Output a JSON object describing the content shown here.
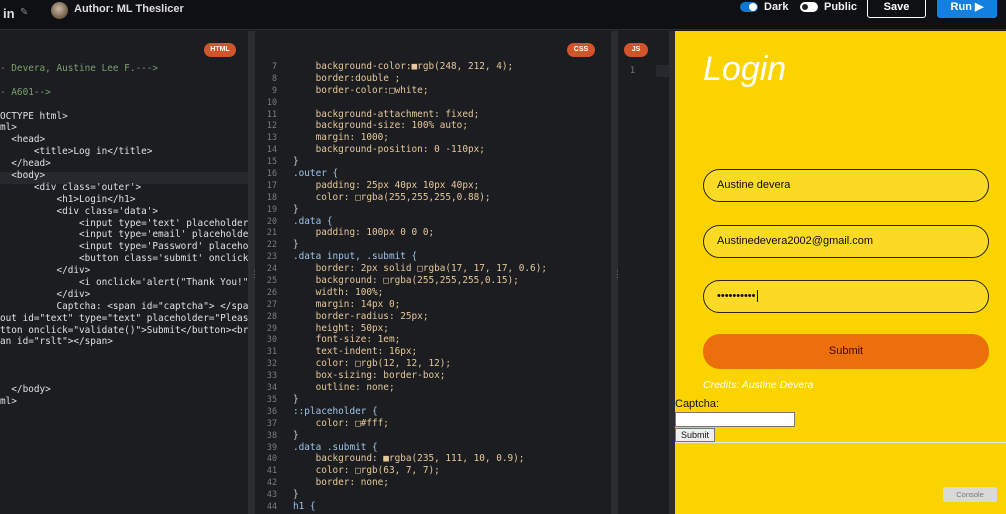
{
  "topbar": {
    "title": "in",
    "author": "Author: ML Theslicer",
    "dark_label": "Dark",
    "public_label": "Public",
    "save_label": "Save",
    "run_label": "Run ▶"
  },
  "tabs": {
    "html": "HTML",
    "css": "CSS",
    "js": "JS"
  },
  "html_lines": [
    {
      "t": "- Devera, Austine Lee F.--->",
      "c": "com"
    },
    {
      "t": "",
      "c": ""
    },
    {
      "t": "- A601-->",
      "c": "com"
    },
    {
      "t": "",
      "c": ""
    },
    {
      "t": "OCTYPE html>",
      "c": "tag"
    },
    {
      "t": "ml>",
      "c": "tag"
    },
    {
      "t": "  <head>",
      "c": "tag"
    },
    {
      "t": "      <title>Log in</title>",
      "c": "tag"
    },
    {
      "t": "  </head>",
      "c": "tag"
    },
    {
      "t": "  <body>",
      "c": "tag"
    },
    {
      "t": "      <div class='outer'>",
      "c": "tag"
    },
    {
      "t": "          <h1>Login</h1>",
      "c": "tag"
    },
    {
      "t": "          <div class='data'>",
      "c": "tag"
    },
    {
      "t": "              <input type='text' placeholder='Na",
      "c": "tag"
    },
    {
      "t": "              <input type='email' placeholder='",
      "c": "tag"
    },
    {
      "t": "              <input type='Password' placeholder",
      "c": "tag"
    },
    {
      "t": "              <button class='submit' onclick='a",
      "c": "tag"
    },
    {
      "t": "          </div>",
      "c": "tag"
    },
    {
      "t": "              <i onclick='alert(\"Thank You!\")'>",
      "c": "tag"
    },
    {
      "t": "          </div>",
      "c": "tag"
    },
    {
      "t": "          Captcha: <span id=\"captcha\"> </span>",
      "c": "tag"
    },
    {
      "t": "out id=\"text\" type=\"text\" placeholder=\"Please",
      "c": "tag"
    },
    {
      "t": "tton onclick=\"validate()\">Submit</button><br /",
      "c": "tag"
    },
    {
      "t": "an id=\"rslt\"></span>",
      "c": "tag"
    },
    {
      "t": "",
      "c": ""
    },
    {
      "t": "",
      "c": ""
    },
    {
      "t": "",
      "c": ""
    },
    {
      "t": "  </body>",
      "c": "tag"
    },
    {
      "t": "ml>",
      "c": "tag"
    }
  ],
  "css_lines": [
    {
      "n": "7",
      "t": "    background-color:■rgb(248, 212, 4);"
    },
    {
      "n": "8",
      "t": "    border:double ;"
    },
    {
      "n": "9",
      "t": "    border-color:□white;"
    },
    {
      "n": "10",
      "t": ""
    },
    {
      "n": "11",
      "t": "    background-attachment: fixed;"
    },
    {
      "n": "12",
      "t": "    background-size: 100% auto;"
    },
    {
      "n": "13",
      "t": "    margin: 1000;"
    },
    {
      "n": "14",
      "t": "    background-position: 0 -110px;"
    },
    {
      "n": "15",
      "t": "}"
    },
    {
      "n": "16",
      "t": ".outer {"
    },
    {
      "n": "17",
      "t": "    padding: 25px 40px 10px 40px;"
    },
    {
      "n": "18",
      "t": "    color: □rgba(255,255,255,0.88);"
    },
    {
      "n": "19",
      "t": "}"
    },
    {
      "n": "20",
      "t": ".data {"
    },
    {
      "n": "21",
      "t": "    padding: 100px 0 0 0;"
    },
    {
      "n": "22",
      "t": "}"
    },
    {
      "n": "23",
      "t": ".data input, .submit {"
    },
    {
      "n": "24",
      "t": "    border: 2px solid □rgba(17, 17, 17, 0.6);"
    },
    {
      "n": "25",
      "t": "    background: □rgba(255,255,255,0.15);"
    },
    {
      "n": "26",
      "t": "    width: 100%;"
    },
    {
      "n": "27",
      "t": "    margin: 14px 0;"
    },
    {
      "n": "28",
      "t": "    border-radius: 25px;"
    },
    {
      "n": "29",
      "t": "    height: 50px;"
    },
    {
      "n": "30",
      "t": "    font-size: 1em;"
    },
    {
      "n": "31",
      "t": "    text-indent: 16px;"
    },
    {
      "n": "32",
      "t": "    color: □rgb(12, 12, 12);"
    },
    {
      "n": "33",
      "t": "    box-sizing: border-box;"
    },
    {
      "n": "34",
      "t": "    outline: none;"
    },
    {
      "n": "35",
      "t": "}"
    },
    {
      "n": "36",
      "t": "::placeholder {"
    },
    {
      "n": "37",
      "t": "    color: □#fff;"
    },
    {
      "n": "38",
      "t": "}"
    },
    {
      "n": "39",
      "t": ".data .submit {"
    },
    {
      "n": "40",
      "t": "    background: ■rgba(235, 111, 10, 0.9);"
    },
    {
      "n": "41",
      "t": "    color: □rgb(63, 7, 7);"
    },
    {
      "n": "42",
      "t": "    border: none;"
    },
    {
      "n": "43",
      "t": "}"
    },
    {
      "n": "44",
      "t": "h1 {"
    }
  ],
  "js_lines": [
    {
      "n": "1",
      "t": ""
    }
  ],
  "preview": {
    "heading": "Login",
    "name_value": "Austine devera",
    "email_value": "Austinedevera2002@gmail.com",
    "password_value": "••••••••••",
    "submit_label": "Submit",
    "credits": "Credits: Austine Devera",
    "captcha_label": "Captcha:",
    "captcha_input_value": "",
    "captcha_submit": "Submit"
  },
  "console_label": "Console",
  "colors": {
    "accent": "#1380e0",
    "tag_bg": "#d1542c",
    "preview_bg": "#fbd400",
    "submit_bg": "#eb6f0a"
  }
}
